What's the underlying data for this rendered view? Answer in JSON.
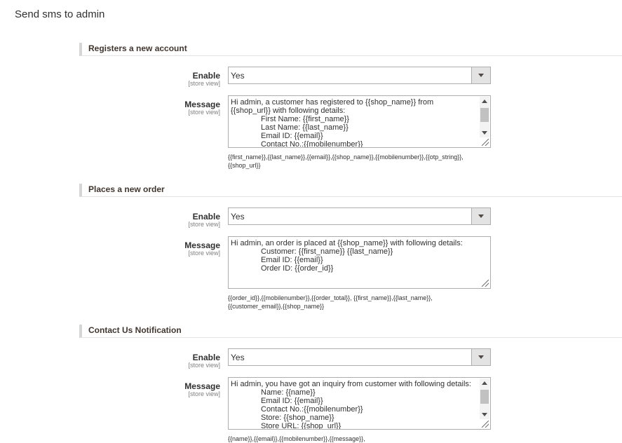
{
  "page": {
    "title": "Send sms to admin"
  },
  "common": {
    "enable_label": "Enable",
    "message_label": "Message",
    "scope": "[store view]"
  },
  "sections": [
    {
      "title": "Registers a new account",
      "enable_value": "Yes",
      "message_lines": [
        "Hi admin, a customer has registered to {{shop_name}} from",
        "{{shop_url}} with following details:",
        "First Name: {{first_name}}",
        "Last Name: {{last_name}}",
        "Email ID: {{email}}",
        "Contact No.:{{mobilenumber}}"
      ],
      "variables": "{{first_name}},{{last_name}},{{email}},{{shop_name}},{{mobilenumber}},{{otp_string}},",
      "variables_2": "{{shop_url}}"
    },
    {
      "title": "Places a new order",
      "enable_value": "Yes",
      "message_lines": [
        "Hi admin, an order is placed at {{shop_name}} with following details:",
        "Customer: {{first_name}} {{last_name}}",
        "Email ID: {{email}}",
        "Order ID: {{order_id}}"
      ],
      "variables": "{{order_id}},{{mobilenumber}},{{order_total}}, {{first_name}},{{last_name}},",
      "variables_2": "{{customer_email}},{{shop_name}}"
    },
    {
      "title": "Contact Us Notification",
      "enable_value": "Yes",
      "message_lines": [
        "Hi admin, you have got an inquiry from customer with following details:",
        "Name: {{name}}",
        "Email ID: {{email}}",
        "Contact No.:{{mobilenumber}}",
        "Store: {{shop_name}}",
        "Store URL: {{shop_url}}"
      ],
      "variables": "{{name}},{{email}},{{mobilenumber}},{{message}},"
    }
  ]
}
